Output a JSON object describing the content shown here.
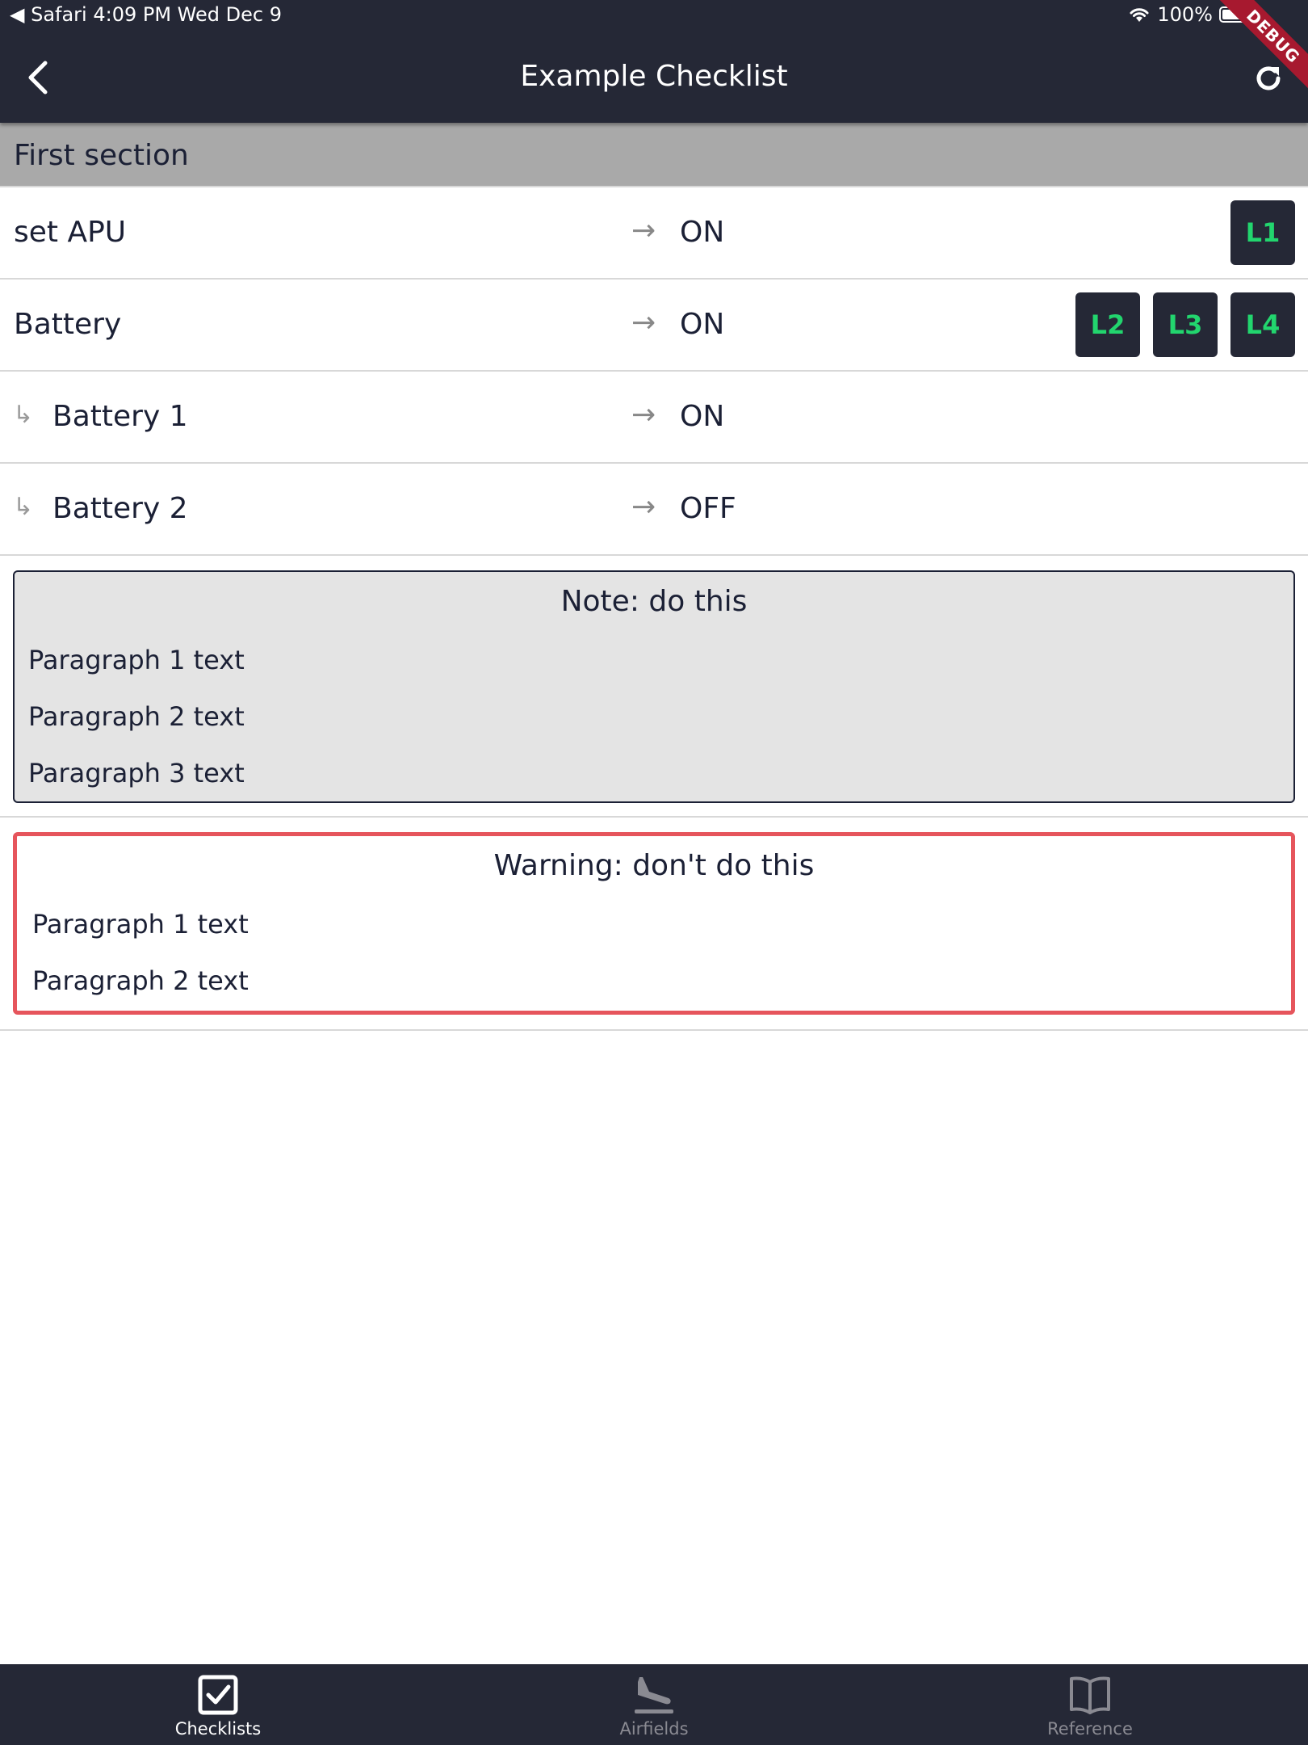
{
  "status_bar": {
    "left": "◀ Safari   4:09 PM   Wed Dec 9",
    "battery": "100%",
    "debug_banner": "DEBUG"
  },
  "app_bar": {
    "title": "Example Checklist",
    "back_icon": "chevron-left-icon",
    "refresh_icon": "refresh-icon"
  },
  "section": {
    "title": "First section"
  },
  "items": [
    {
      "name": "set APU",
      "arrow": "→",
      "value": "ON",
      "tags": [
        "L1"
      ]
    },
    {
      "name": "Battery",
      "arrow": "→",
      "value": "ON",
      "tags": [
        "L2",
        "L3",
        "L4"
      ]
    },
    {
      "sub_marker": "↳",
      "name": "Battery 1",
      "arrow": "→",
      "value": "ON"
    },
    {
      "sub_marker": "↳",
      "name": "Battery 2",
      "arrow": "→",
      "value": "OFF"
    }
  ],
  "note": {
    "title": "Note: do this",
    "paragraphs": [
      "Paragraph 1 text",
      "Paragraph 2 text",
      "Paragraph 3 text"
    ]
  },
  "warning": {
    "title": "Warning: don't do this",
    "paragraphs": [
      "Paragraph 1 text",
      "Paragraph 2 text"
    ]
  },
  "bottom_nav": [
    {
      "label": "Checklists",
      "icon": "checkbox-icon",
      "active": true
    },
    {
      "label": "Airfields",
      "icon": "airplane-landing-icon",
      "active": false
    },
    {
      "label": "Reference",
      "icon": "book-icon",
      "active": false
    }
  ],
  "colors": {
    "bar_background": "#252836",
    "tag_text": "#22d56e",
    "warning_border": "#e6555c",
    "section_background": "#a9a9a9",
    "note_background": "#e4e4e4"
  }
}
